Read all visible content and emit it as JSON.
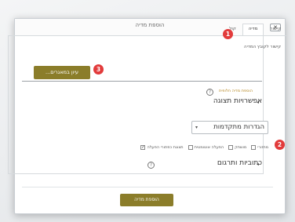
{
  "dialog": {
    "title": "הוספת מדיה",
    "close_label": "✕"
  },
  "tabs": [
    {
      "label": "קישור",
      "active": false
    },
    {
      "label": "מדיה",
      "active": true
    },
    {
      "label": "קול",
      "active": false
    }
  ],
  "link": {
    "label": "קישור לקובץ המדיה",
    "browse_label": "עיון במאגרים...",
    "value": ""
  },
  "optional": {
    "label": "הוספת מדיה חלופית"
  },
  "display_section": {
    "title": "אפשרויות תצוגה"
  },
  "advanced": {
    "value": "הגדרות מתקדמות"
  },
  "checkboxes": [
    {
      "label": "תצוגת כפתורי הפעלה",
      "checked": true
    },
    {
      "label": "הפעלה אוטומטית",
      "checked": false
    },
    {
      "label": "מושתק",
      "checked": false
    },
    {
      "label": "מחזורי",
      "checked": false
    }
  ],
  "subtitles_section": {
    "title": "כתוביות ותרגום"
  },
  "footer": {
    "insert_label": "הוספת מדיה"
  },
  "badges": [
    "1",
    "2",
    "3"
  ],
  "icons": {
    "help": "?",
    "chevron": "◂",
    "caret": "▾",
    "check": "✓"
  },
  "colors": {
    "primary_button": "#8b7d2a",
    "badge": "#e23b3b",
    "optional_label": "#b5851e"
  }
}
